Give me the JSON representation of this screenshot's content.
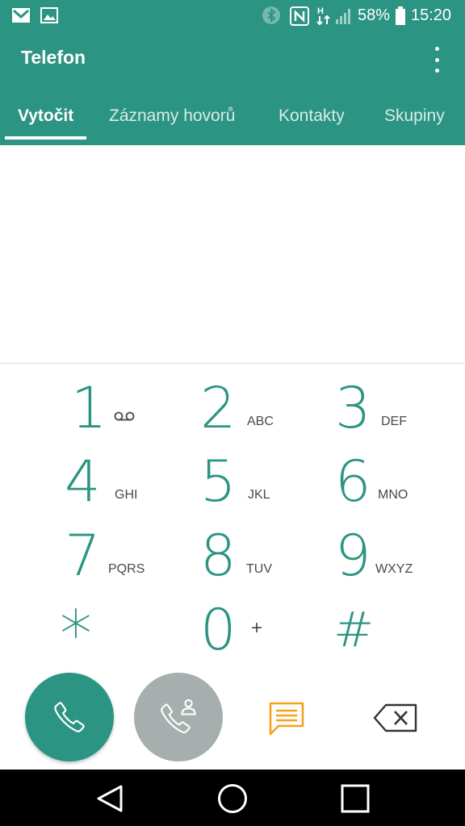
{
  "status_bar": {
    "battery_percent": "58%",
    "time": "15:20",
    "icons": [
      "gmail-icon",
      "gallery-icon",
      "bluetooth-icon",
      "nfc-icon",
      "hplus-data-icon",
      "signal-icon",
      "battery-icon"
    ]
  },
  "app": {
    "title": "Telefon"
  },
  "tabs": [
    {
      "label": "Vytočit",
      "active": true
    },
    {
      "label": "Záznamy hovorů",
      "active": false
    },
    {
      "label": "Kontakty",
      "active": false
    },
    {
      "label": "Skupiny",
      "active": false
    }
  ],
  "dialed_number": "",
  "keypad": [
    {
      "digit": "1",
      "letters": ""
    },
    {
      "digit": "2",
      "letters": "ABC"
    },
    {
      "digit": "3",
      "letters": "DEF"
    },
    {
      "digit": "4",
      "letters": "GHI"
    },
    {
      "digit": "5",
      "letters": "JKL"
    },
    {
      "digit": "6",
      "letters": "MNO"
    },
    {
      "digit": "7",
      "letters": "PQRS"
    },
    {
      "digit": "8",
      "letters": "TUV"
    },
    {
      "digit": "9",
      "letters": "WXYZ"
    },
    {
      "digit": "*",
      "letters": ""
    },
    {
      "digit": "0",
      "letters": "+"
    },
    {
      "digit": "#",
      "letters": ""
    }
  ],
  "colors": {
    "accent": "#2b9482",
    "secondary_button": "#a6aeae",
    "message_icon": "#f5a11c",
    "nav_bar": "#000000"
  }
}
